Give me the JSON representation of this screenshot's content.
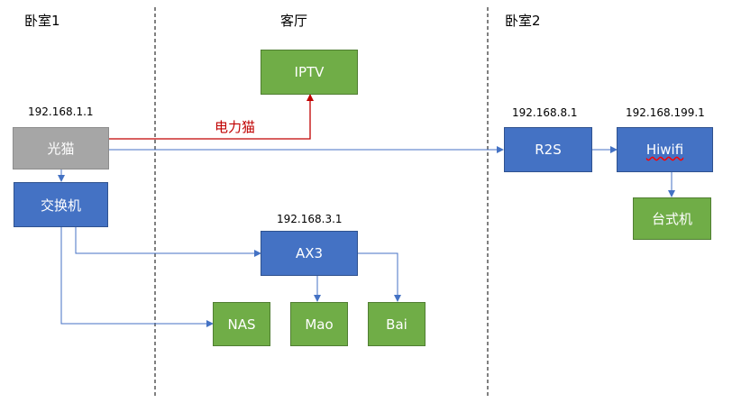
{
  "rooms": {
    "bedroom1": "卧室1",
    "living": "客厅",
    "bedroom2": "卧室2"
  },
  "nodes": {
    "modem": "光猫",
    "switch": "交换机",
    "iptv": "IPTV",
    "ax3": "AX3",
    "nas": "NAS",
    "mao": "Mao",
    "bai": "Bai",
    "r2s": "R2S",
    "hiwifi": "Hiwifi",
    "desktop": "台式机"
  },
  "ips": {
    "modem": "192.168.1.1",
    "ax3": "192.168.3.1",
    "r2s": "192.168.8.1",
    "hiwifi": "192.168.199.1"
  },
  "labels": {
    "plc": "电力猫"
  },
  "colors": {
    "router": "#4472c4",
    "device": "#70ad47",
    "modem": "#a6a6a6",
    "link": "#4472c4",
    "plc_link": "#c00000"
  }
}
